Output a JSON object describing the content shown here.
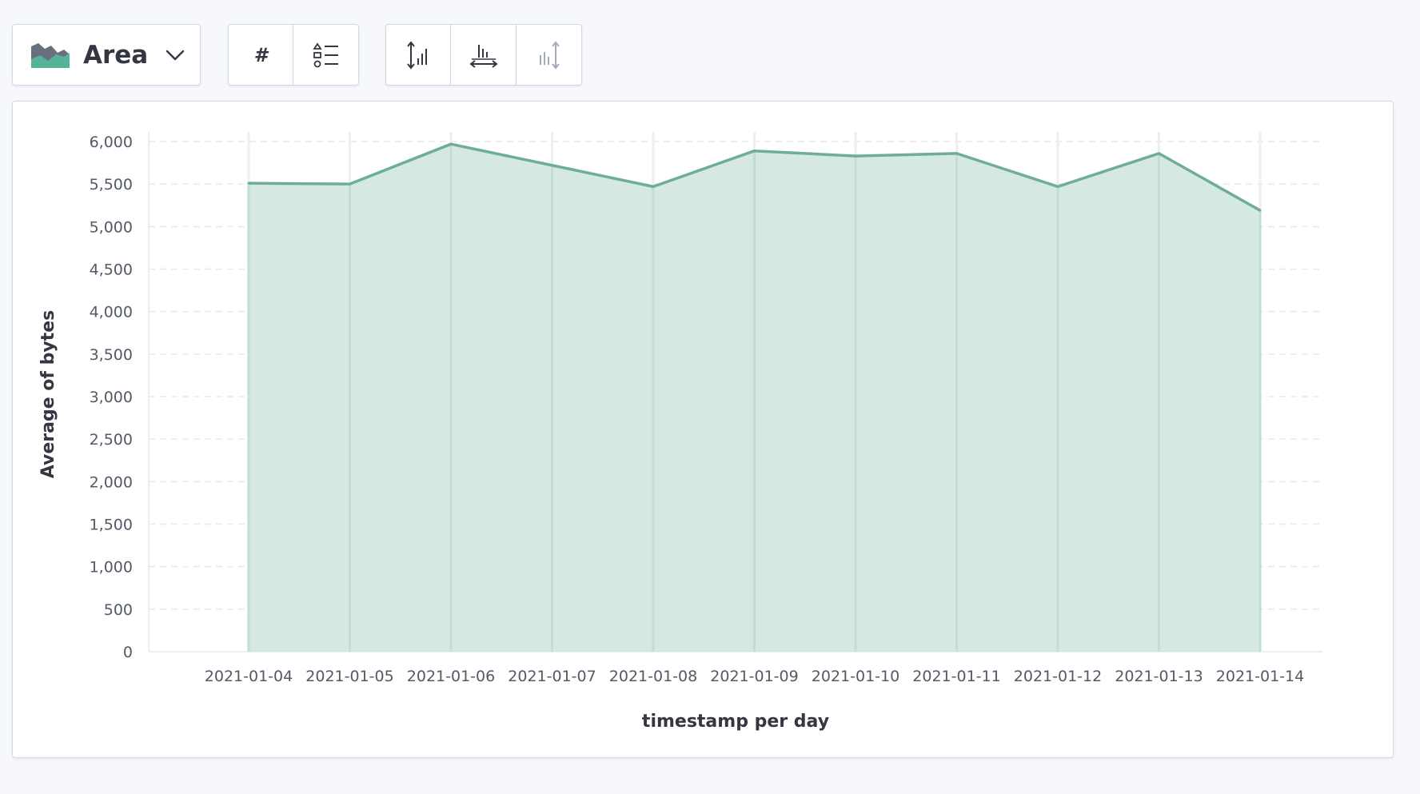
{
  "toolbar": {
    "chart_type_label": "Area",
    "chart_type_icon": "area-chart-icon",
    "value_format_icon": "hash-icon",
    "legend_icon": "list-icon",
    "axis_buttons": [
      "y-axis-scale-icon",
      "x-axis-scale-icon",
      "y-right-axis-scale-icon"
    ],
    "hash_symbol": "#"
  },
  "colors": {
    "series_line": "#6dae95",
    "series_fill": "#d3e7df",
    "grid": "#e6e9ef"
  },
  "chart_data": {
    "type": "area",
    "categories": [
      "2021-01-04",
      "2021-01-05",
      "2021-01-06",
      "2021-01-07",
      "2021-01-08",
      "2021-01-09",
      "2021-01-10",
      "2021-01-11",
      "2021-01-12",
      "2021-01-13",
      "2021-01-14"
    ],
    "series": [
      {
        "values": [
          5510,
          5500,
          5970,
          5720,
          5470,
          5890,
          5830,
          5860,
          5470,
          5860,
          5190
        ]
      }
    ],
    "xlabel": "timestamp per day",
    "ylabel": "Average of bytes",
    "ylim": [
      0,
      6000
    ],
    "yticks": [
      0,
      500,
      1000,
      1500,
      2000,
      2500,
      3000,
      3500,
      4000,
      4500,
      5000,
      5500,
      6000
    ],
    "ytick_labels": [
      "0",
      "500",
      "1,000",
      "1,500",
      "2,000",
      "2,500",
      "3,000",
      "3,500",
      "4,000",
      "4,500",
      "5,000",
      "5,500",
      "6,000"
    ],
    "grid": true,
    "legend": "none"
  }
}
